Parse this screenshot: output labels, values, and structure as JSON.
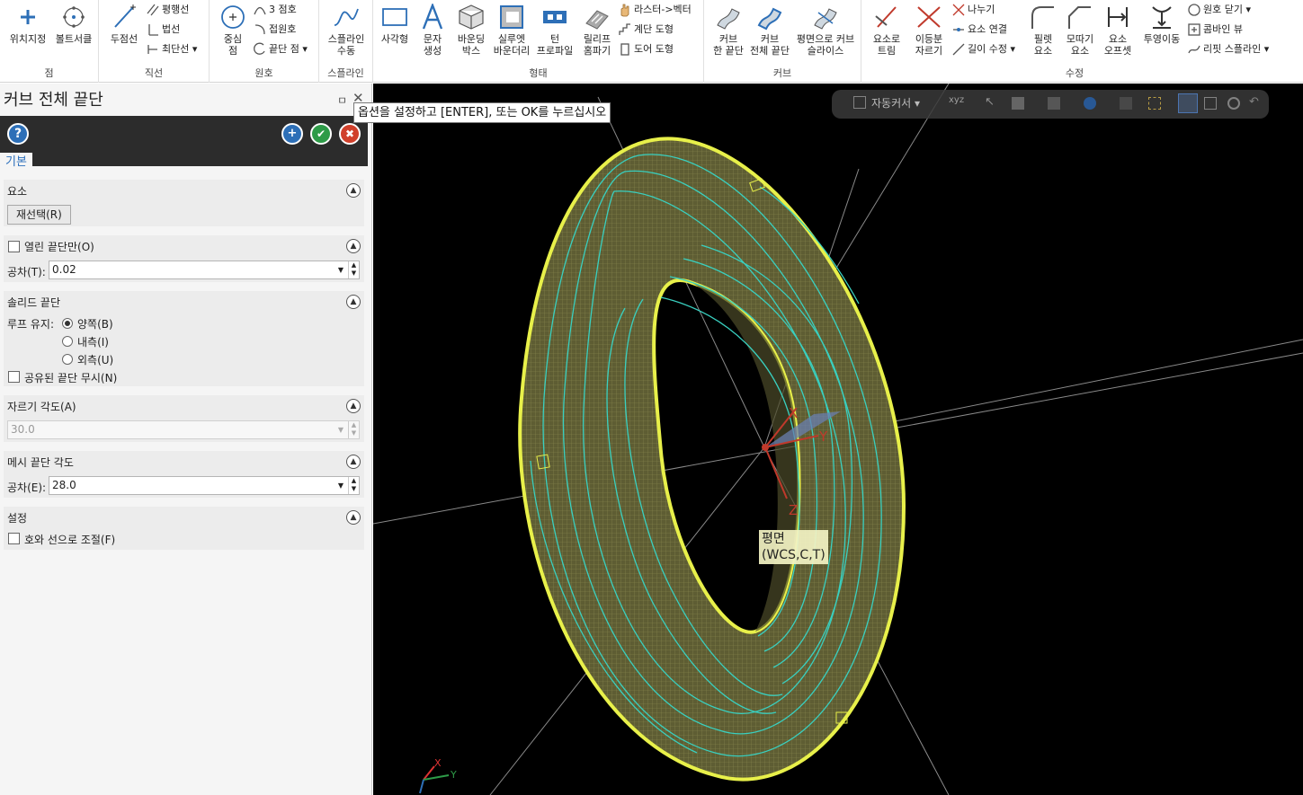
{
  "ribbon": {
    "groups": {
      "point": "점",
      "line": "직선",
      "arc": "원호",
      "spline": "스플라인",
      "shape": "형태",
      "curve": "커브",
      "modify": "수정"
    },
    "point": {
      "position": "위치지정",
      "bolt_circle": "볼트서클"
    },
    "line": {
      "endpoints": "두점선",
      "parallel": "평행선",
      "normal": "법선",
      "shortest": "최단선"
    },
    "arc": {
      "center_line1": "중심",
      "center_line2": "점",
      "three_point": "3 점호",
      "tangent": "접원호",
      "endpoint": "끝단 점"
    },
    "spline": {
      "manual_line1": "스플라인",
      "manual_line2": "수동"
    },
    "shape": {
      "rectangle": "사각형",
      "text_line1": "문자",
      "text_line2": "생성",
      "bbox_line1": "바운딩",
      "bbox_line2": "박스",
      "silhouette_line1": "실루엣",
      "silhouette_line2": "바운더리",
      "turn_line1": "턴",
      "turn_line2": "프로파일",
      "relief_line1": "릴리프",
      "relief_line2": "홈파기",
      "raster_vector": "라스터->벡터",
      "stair": "계단 도형",
      "door": "도어 도형"
    },
    "curve": {
      "one_edge_line1": "커브",
      "one_edge_line2": "한 끝단",
      "all_edges_line1": "커브",
      "all_edges_line2": "전체 끝단",
      "slice_line1": "평면으로 커브",
      "slice_line2": "슬라이스"
    },
    "modify": {
      "trim_line1": "요소로",
      "trim_line2": "트림",
      "divide_line1": "이등분",
      "divide_line2": "자르기",
      "break": "나누기",
      "join": "요소 연결",
      "modify_length": "길이 수정",
      "fillet_line1": "필렛",
      "fillet_line2": "요소",
      "chamfer_line1": "모따기",
      "chamfer_line2": "요소",
      "offset_line1": "요소",
      "offset_line2": "오프셋",
      "project": "투영이동",
      "close_arc": "원호 닫기",
      "combine_view": "콤바인 뷰",
      "rebuild_spline": "리핏 스플라인"
    }
  },
  "panel": {
    "title": "커브 전체 끝단",
    "pin": "ㅁ",
    "close": "✕",
    "help": "?",
    "ok_new": "+",
    "ok": "✔",
    "cancel": "✖",
    "tab": "기본",
    "elements": {
      "header": "요소",
      "reselect": "재선택(R)"
    },
    "open_edges": {
      "header": "열린 끝단만(O)",
      "tolerance_label": "공차(T):",
      "tolerance_value": "0.02"
    },
    "solid_edges": {
      "header": "솔리드 끝단",
      "loop_label": "루프 유지:",
      "opt_both": "양쪽(B)",
      "opt_inner": "내측(I)",
      "opt_outer": "외측(U)",
      "ignore_shared": "공유된 끝단 무시(N)"
    },
    "break_angle": {
      "header": "자르기 각도(A)",
      "value": "30.0"
    },
    "mesh_edge_angle": {
      "header": "메시 끝단 각도",
      "tolerance_label": "공차(E):",
      "value": "28.0"
    },
    "settings": {
      "header": "설정",
      "adjust_arcs": "호와 선으로 조절(F)"
    }
  },
  "viewport": {
    "tooltip": "옵션을 설정하고 [ENTER], 또는 OK를 누르십시오",
    "autocursor": "자동커서",
    "plane_label": "평면",
    "plane_info": "(WCS,C,T)",
    "axis_x": "X",
    "axis_y": "Y",
    "axis_z": "Z",
    "colors": {
      "background": "#000000",
      "ring_fill": "#6b6a3a",
      "wire": "#39d0c0",
      "highlight": "#e8f04a"
    }
  }
}
